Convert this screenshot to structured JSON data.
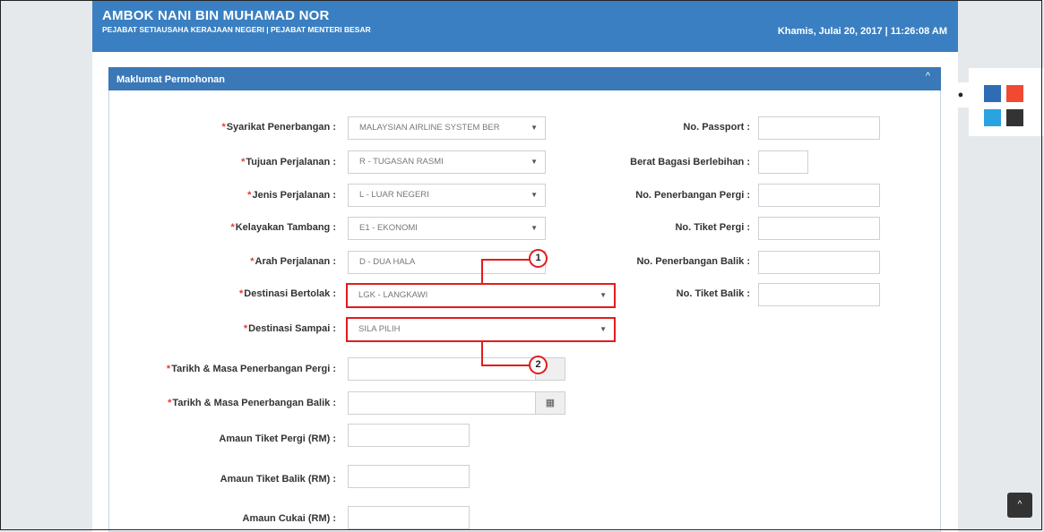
{
  "header": {
    "user_name": "AMBOK NANI BIN MUHAMAD NOR",
    "department": "PEJABAT SETIAUSAHA KERAJAAN NEGERI | PEJABAT MENTERI BESAR",
    "datetime": "Khamis, Julai 20, 2017 | 11:26:08 AM"
  },
  "panel": {
    "title": "Maklumat Permohonan",
    "collapse_icon": "chevron-up-icon"
  },
  "required_marker": "*",
  "left_fields": [
    {
      "label": "Syarikat Penerbangan :",
      "value": "MALAYSIAN AIRLINE SYSTEM BER",
      "required": true
    },
    {
      "label": "Tujuan Perjalanan :",
      "value": "R - TUGASAN RASMI",
      "required": true
    },
    {
      "label": "Jenis Perjalanan :",
      "value": "L - LUAR NEGERI",
      "required": true
    },
    {
      "label": "Kelayakan Tambang :",
      "value": "E1 - EKONOMI",
      "required": true
    },
    {
      "label": "Arah Perjalanan :",
      "value": "D - DUA HALA",
      "required": true
    },
    {
      "label": "Destinasi Bertolak :",
      "value": "LGK - LANGKAWI",
      "required": true
    },
    {
      "label": "Destinasi Sampai :",
      "value": "SILA PILIH",
      "required": true
    },
    {
      "label": "Tarikh & Masa Penerbangan Pergi :",
      "value": "",
      "required": true
    },
    {
      "label": "Tarikh & Masa Penerbangan Balik :",
      "value": "",
      "required": true
    },
    {
      "label": "Amaun Tiket Pergi (RM) :",
      "value": "",
      "required": false
    },
    {
      "label": "Amaun Tiket Balik (RM) :",
      "value": "",
      "required": false
    },
    {
      "label": "Amaun Cukai (RM) :",
      "value": "",
      "required": false
    }
  ],
  "right_fields": [
    {
      "label": "No. Passport :",
      "value": ""
    },
    {
      "label": "Berat Bagasi Berlebihan :",
      "value": ""
    },
    {
      "label": "No. Penerbangan Pergi :",
      "value": ""
    },
    {
      "label": "No. Tiket Pergi :",
      "value": ""
    },
    {
      "label": "No. Penerbangan Balik :",
      "value": ""
    },
    {
      "label": "No. Tiket Balik :",
      "value": ""
    }
  ],
  "callouts": [
    "1",
    "2"
  ],
  "icons": {
    "dropdown": "caret-down-icon",
    "calendar": "calendar-icon",
    "theme": "water-drop-icon",
    "scroll_top": "chevron-up-icon"
  },
  "theme_colors": [
    "#2e6db4",
    "#f04a32",
    "#2aa3e0",
    "#333333"
  ],
  "glyphs": {
    "caret": "▼",
    "chevron_up": "^",
    "calendar": "▦",
    "drop": "●"
  }
}
